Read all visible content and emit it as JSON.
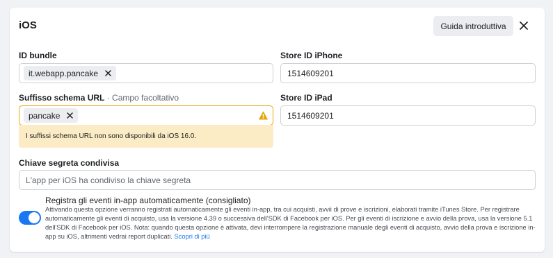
{
  "header": {
    "title": "iOS",
    "guide_label": "Guida introduttiva"
  },
  "bundle_id": {
    "label": "ID bundle",
    "chip": "it.webapp.pancake"
  },
  "store_iphone": {
    "label": "Store ID iPhone",
    "value": "1514609201"
  },
  "url_scheme": {
    "label": "Suffisso schema URL",
    "optional": " · Campo facoltativo",
    "chip": "pancake",
    "warning": "I suffissi schema URL non sono disponibili da iOS 16.0."
  },
  "store_ipad": {
    "label": "Store ID iPad",
    "value": "1514609201"
  },
  "shared_secret": {
    "label": "Chiave segreta condivisa",
    "placeholder": "L'app per iOS ha condiviso la chiave segreta"
  },
  "auto_events": {
    "title": "Registra gli eventi in-app automaticamente (consigliato)",
    "description": "Attivando questa opzione verranno registrati automaticamente gli eventi in-app, tra cui acquisti, avvii di prove e iscrizioni, elaborati tramite iTunes Store. Per registrare automaticamente gli eventi di acquisto, usa la versione 4.39 o successiva dell'SDK di Facebook per iOS. Per gli eventi di iscrizione e avvio della prova, usa la versione 5.1 dell'SDK di Facebook per iOS. Nota: quando questa opzione è attivata, devi interrompere la registrazione manuale degli eventi di acquisto, avvio della prova e iscrizione in-app su iOS, altrimenti vedrai report duplicati.",
    "link": "Scopri di più",
    "enabled": true
  },
  "colors": {
    "accent": "#1877f2",
    "warning_border": "#e5a70d",
    "warning_bg": "#fcecc5"
  },
  "icons": [
    "close-icon",
    "chip-remove-icon",
    "warning-icon"
  ]
}
